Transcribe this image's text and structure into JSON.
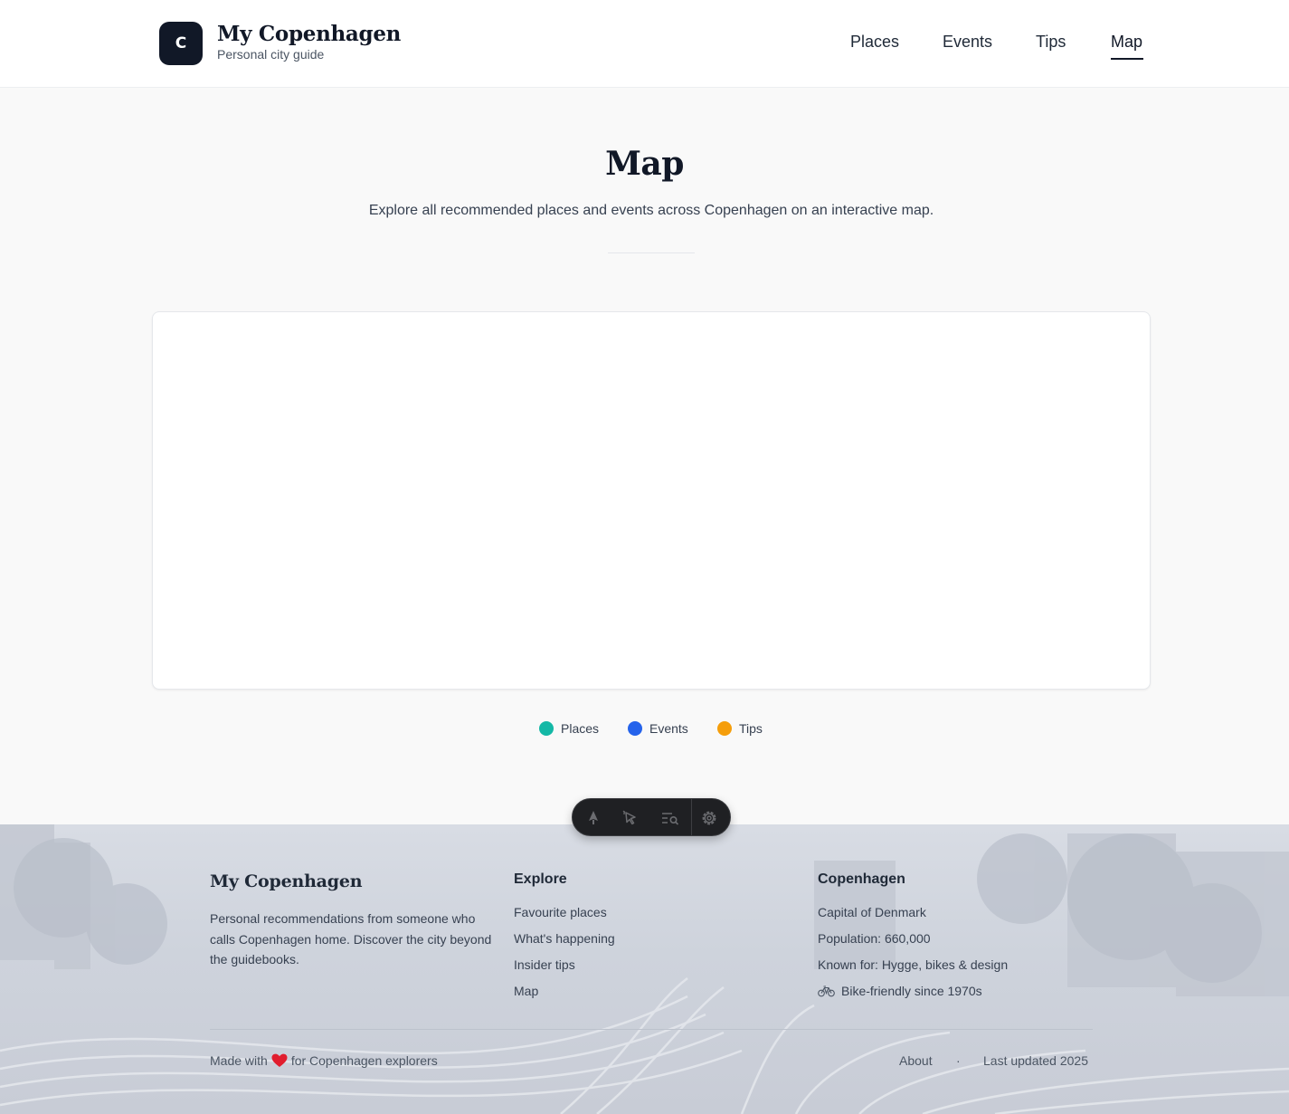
{
  "header": {
    "logo_letter": "C",
    "brand_title": "My Copenhagen",
    "brand_subtitle": "Personal city guide",
    "nav": [
      {
        "label": "Places",
        "active": false
      },
      {
        "label": "Events",
        "active": false
      },
      {
        "label": "Tips",
        "active": false
      },
      {
        "label": "Map",
        "active": true
      }
    ]
  },
  "hero": {
    "title": "Map",
    "description": "Explore all recommended places and events across Copenhagen on an interactive map."
  },
  "legend": [
    {
      "label": "Places",
      "color": "#14b8a6"
    },
    {
      "label": "Events",
      "color": "#2563eb"
    },
    {
      "label": "Tips",
      "color": "#f59e0b"
    }
  ],
  "toolbar": {
    "icons": [
      "pin-icon",
      "select-cursor-icon",
      "search-list-icon",
      "gear-icon"
    ]
  },
  "footer": {
    "brand": "My Copenhagen",
    "description": "Personal recommendations from someone who calls Copenhagen home. Discover the city beyond the guidebooks.",
    "explore": {
      "heading": "Explore",
      "links": [
        "Favourite places",
        "What's happening",
        "Insider tips",
        "Map"
      ]
    },
    "city": {
      "heading": "Copenhagen",
      "facts": [
        "Capital of Denmark",
        "Population: 660,000",
        "Known for: Hygge, bikes & design",
        "Bike-friendly since 1970s"
      ]
    },
    "bottom": {
      "made_with_prefix": "Made with",
      "made_with_suffix": "for Copenhagen explorers",
      "about": "About",
      "separator": "·",
      "last_updated": "Last updated 2025"
    }
  }
}
